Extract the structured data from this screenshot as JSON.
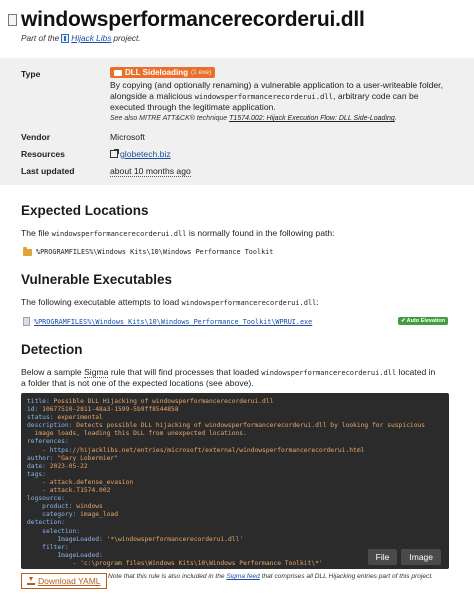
{
  "header": {
    "title": "windowsperformancerecorderui.dll",
    "part_of_prefix": "Part of the",
    "project_link": "Hijack Libs",
    "part_of_suffix": "project."
  },
  "info": {
    "type_label": "Type",
    "badge": "DLL Sideloading",
    "badge_sub": "(1 exe)",
    "desc_1": "By copying (and optionally renaming) a vulnerable application to a user-writeable folder, alongside a malicious",
    "desc_dll": "windowsperformancerecorderui.dll",
    "desc_2": ", arbitrary code can be executed through the legitimate application.",
    "see_also_prefix": "See also MITRE ATT&CK® technique",
    "see_also_link": "T1574.002: Hijack Execution Flow: DLL Side-Loading",
    "see_also_suffix": ".",
    "vendor_label": "Vendor",
    "vendor_value": "Microsoft",
    "resources_label": "Resources",
    "resources_link": "globetech.biz",
    "updated_label": "Last updated",
    "updated_value": "about 10 months ago"
  },
  "expected": {
    "heading": "Expected Locations",
    "text_1": "The file",
    "file": "windowsperformancerecorderui.dll",
    "text_2": "is normally found in the following path:",
    "path": "%PROGRAMFILES%\\Windows Kits\\10\\Windows Performance Toolkit"
  },
  "vulnerable": {
    "heading": "Vulnerable Executables",
    "text": "The following executable attempts to load",
    "file": "windowsperformancerecorderui.dll",
    "text_end": ":",
    "exe_path": "%PROGRAMFILES%\\Windows Kits\\10\\Windows Performance Toolkit\\WPRUI.exe",
    "auto_elevation": "Auto Elevation"
  },
  "detection": {
    "heading": "Detection",
    "text_1": "Below a sample",
    "sigma": "Sigma",
    "text_2": "rule that will find processes that loaded",
    "file": "windowsperformancerecorderui.dll",
    "text_3": "located in a folder that is not one of the expected locations (see above).",
    "code_lines": [
      "title: Possible DLL Hijacking of windowsperformancerecorderui.dll",
      "id: 10677510-2811-48a3-1599-5b9ff8544858",
      "status: experimental",
      "description: Detects possible DLL hijacking of windowsperformancerecorderui.dll by looking for suspicious",
      "  image loads, loading this DLL from unexpected locations.",
      "references:",
      "    - https://hijacklibs.net/entries/microsoft/external/windowsperformancerecorderui.html",
      "author: \"Gary Lobermier\"",
      "date: 2023-05-22",
      "tags:",
      "    - attack.defense_evasion",
      "    - attack.T1574.002",
      "logsource:",
      "    product: windows",
      "    category: image_load",
      "detection:",
      "    selection:",
      "        ImageLoaded: '*\\windowsperformancerecorderui.dll'",
      "    filter:",
      "        ImageLoaded:",
      "            - 'c:\\program files\\Windows Kits\\10\\Windows Performance Toolkit\\*'"
    ],
    "file_btn": "File",
    "image_btn": "Image",
    "download": "Download YAML",
    "note_1": "Note that this rule is also included in the",
    "note_link": "Sigma feed",
    "note_2": "that comprises all DLL Hijacking entries part of this project."
  }
}
